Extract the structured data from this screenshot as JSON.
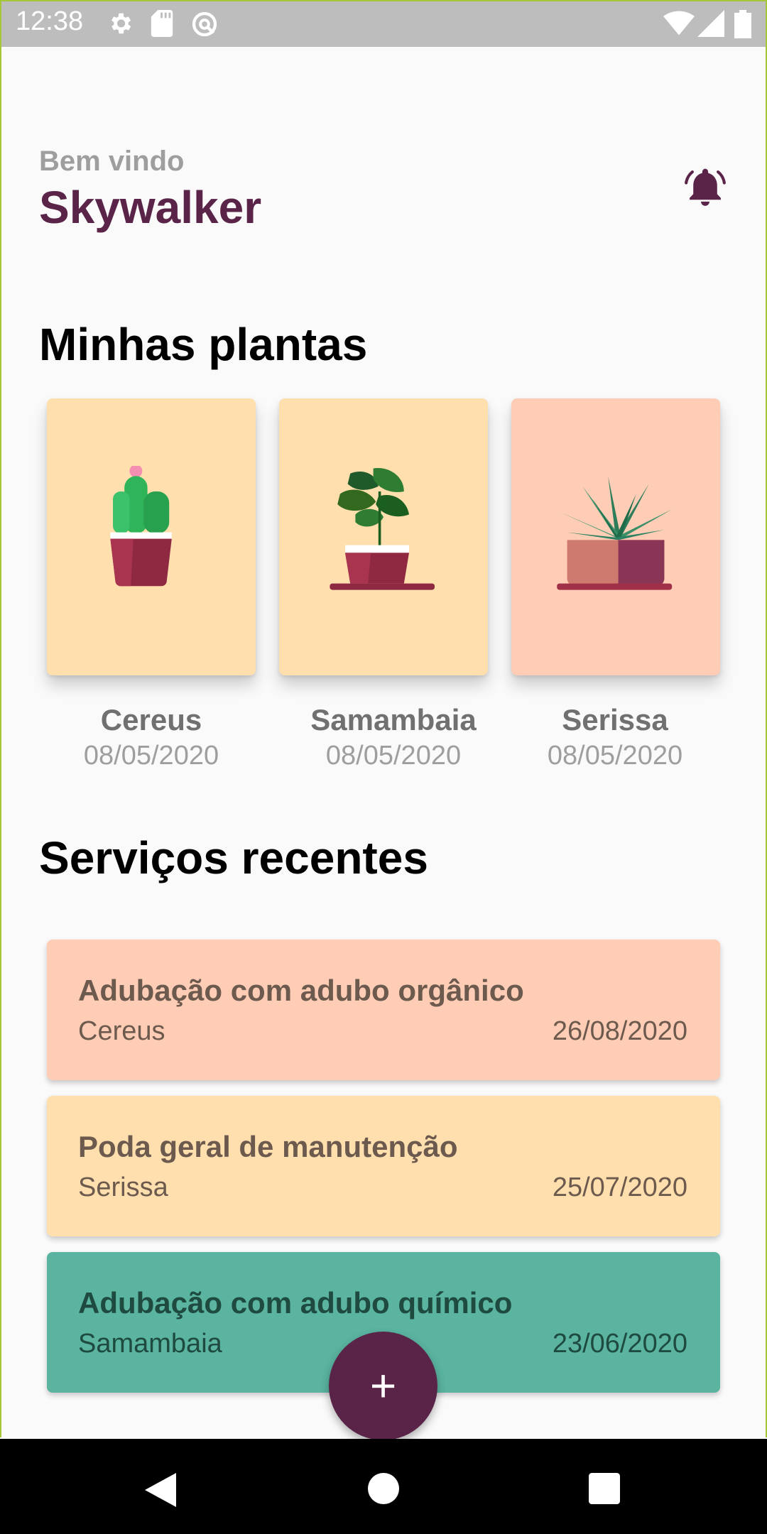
{
  "status_bar": {
    "time": "12:38",
    "icons": [
      "gear-icon",
      "sd-card-icon",
      "sync-icon",
      "wifi-icon",
      "signal-icon",
      "battery-icon"
    ]
  },
  "header": {
    "welcome": "Bem vindo",
    "user_name": "Skywalker",
    "bell_icon": "bell-icon"
  },
  "plants_section": {
    "title": "Minhas plantas",
    "plants": [
      {
        "name": "Cereus",
        "date": "08/05/2020",
        "bg": "#ffdfae",
        "image": "cactus-pot-icon"
      },
      {
        "name": "Samambaia",
        "date": "08/05/2020",
        "bg": "#ffdfae",
        "image": "monstera-pot-icon"
      },
      {
        "name": "Serissa",
        "date": "08/05/2020",
        "bg": "#ffcdb5",
        "image": "aloe-pot-icon"
      }
    ]
  },
  "services_section": {
    "title": "Serviços recentes",
    "services": [
      {
        "title": "Adubação com adubo orgânico",
        "plant": "Cereus",
        "date": "26/08/2020",
        "bg": "#ffcdb5"
      },
      {
        "title": "Poda geral de manutenção",
        "plant": "Serissa",
        "date": "25/07/2020",
        "bg": "#ffdfae"
      },
      {
        "title": "Adubação com adubo químico",
        "plant": "Samambaia",
        "date": "23/06/2020",
        "bg": "#5ab4a0"
      }
    ]
  },
  "fab": {
    "label": "+",
    "icon": "plus-icon"
  },
  "nav_bar": {
    "buttons": [
      "back-icon",
      "home-icon",
      "recents-icon"
    ]
  },
  "colors": {
    "primary": "#5a2449",
    "accent_peach": "#ffcdb5",
    "accent_sand": "#ffdfae",
    "accent_teal": "#5ab4a0"
  }
}
